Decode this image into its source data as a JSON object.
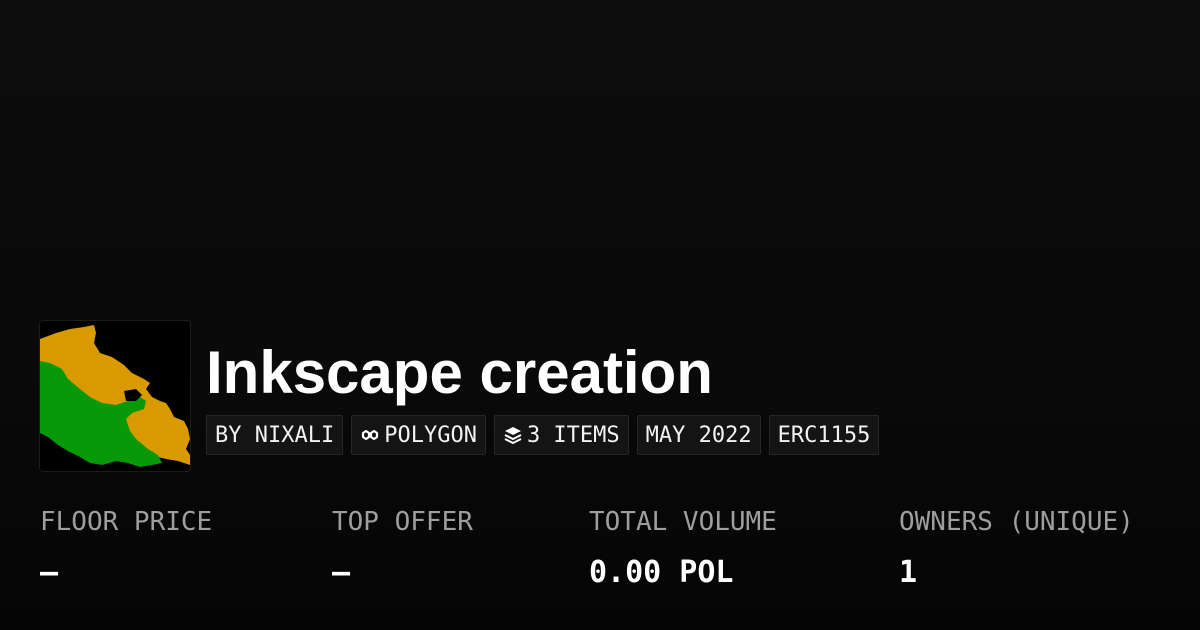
{
  "collection": {
    "title": "Inkscape creation",
    "image_icon": "collection-artwork",
    "tags": {
      "creator": "BY NIXALI",
      "chain": "POLYGON",
      "items": "3 ITEMS",
      "date": "MAY 2022",
      "standard": "ERC1155"
    },
    "tag_icons": {
      "chain": "chain-link-icon",
      "items": "layers-icon"
    }
  },
  "stats": {
    "floor_price": {
      "label": "FLOOR PRICE",
      "value": "–"
    },
    "top_offer": {
      "label": "TOP OFFER",
      "value": "–"
    },
    "total_volume": {
      "label": "TOTAL VOLUME",
      "value": "0.00 POL"
    },
    "owners": {
      "label": "OWNERS (UNIQUE)",
      "value": "1"
    }
  },
  "colors": {
    "background": "#0a0a0a",
    "art_orange": "#d99a00",
    "art_green": "#079907",
    "label_gray": "#9e9e9e"
  }
}
